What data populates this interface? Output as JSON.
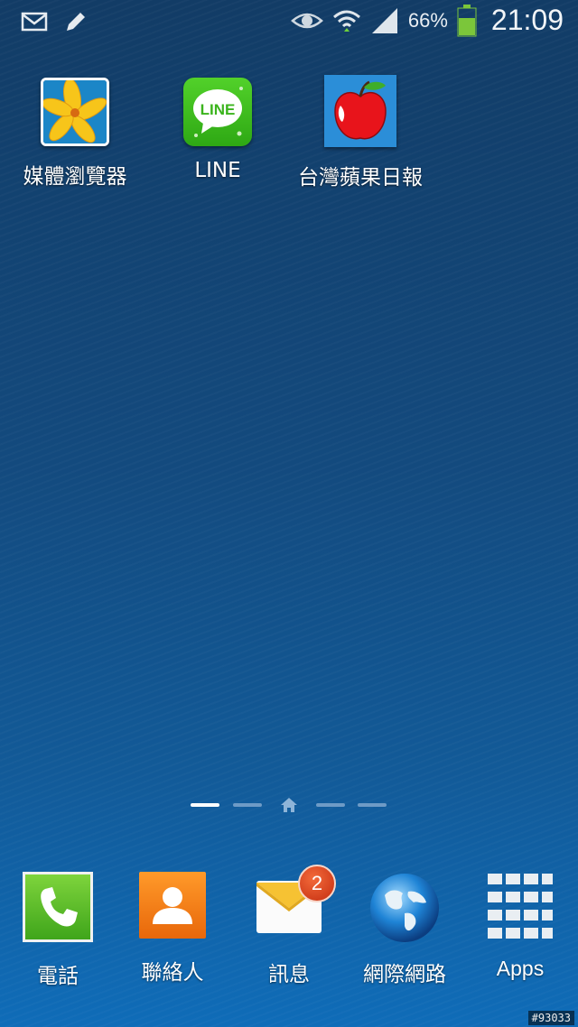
{
  "status_bar": {
    "battery_percent": "66%",
    "time": "21:09",
    "battery_level": 0.66,
    "icons_left": [
      "mail-icon",
      "pencil-icon"
    ],
    "icons_right": [
      "eye-icon",
      "wifi-icon",
      "signal-icon",
      "battery-icon"
    ]
  },
  "home_apps": [
    {
      "label": "媒體瀏覽器",
      "icon": "gallery-icon"
    },
    {
      "label": "LINE",
      "icon": "line-icon",
      "tile_text": "LINE"
    },
    {
      "label": "台灣蘋果日報",
      "icon": "apple-daily-icon"
    }
  ],
  "page_indicator": {
    "pages": 5,
    "home_index": 2,
    "active_index": 0
  },
  "dock": [
    {
      "label": "電話",
      "icon": "phone-icon"
    },
    {
      "label": "聯絡人",
      "icon": "contacts-icon"
    },
    {
      "label": "訊息",
      "icon": "messages-icon",
      "badge": "2"
    },
    {
      "label": "網際網路",
      "icon": "globe-icon"
    },
    {
      "label": "Apps",
      "icon": "apps-grid-icon"
    }
  ],
  "watermark": "#93033",
  "colors": {
    "line_green": "#3bc01e",
    "phone_green": "#55c12a",
    "contacts_orange": "#f07a12",
    "badge_red": "#d2381a"
  }
}
